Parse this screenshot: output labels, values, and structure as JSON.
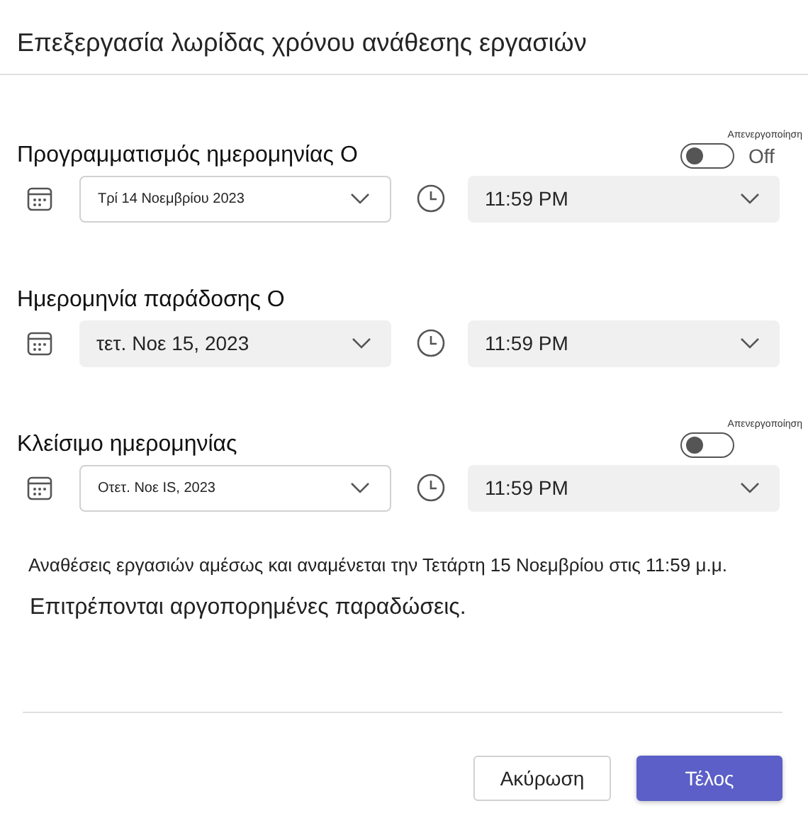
{
  "dialog": {
    "title": "Επεξεργασία λωρίδας χρόνου ανάθεσης εργασιών"
  },
  "sections": [
    {
      "label": "Προγραμματισμός ημερομηνίας Ο",
      "toggle": {
        "caption": "Απενεργοποίηση",
        "state_text": "Off",
        "on": false
      },
      "date": {
        "value": "Τρί 14 Νοεμβρίου 2023",
        "kind": "outlined"
      },
      "time": {
        "value": "11:59 PM"
      }
    },
    {
      "label": "Ημερομηνία παράδοσης Ο",
      "date": {
        "value": "τετ. Νοε 15, 2023",
        "kind": "filled"
      },
      "time": {
        "value": "11:59 PM"
      }
    },
    {
      "label": "Κλείσιμο ημερομηνίας",
      "toggle": {
        "caption": "Απενεργοποίηση",
        "on": false
      },
      "date": {
        "value": "Οτετ. Νοε IS, 2023",
        "kind": "outlined"
      },
      "time": {
        "value": "11:59 PM"
      }
    }
  ],
  "summary": [
    "Αναθέσεις εργασιών αμέσως και αναμένεται την Τετάρτη 15 Νοεμβρίου στις 11:59 μ.μ.",
    "Επιτρέπονται αργοπορημένες παραδώσεις."
  ],
  "buttons": [
    {
      "label": "Ακύρωση",
      "kind": "secondary"
    },
    {
      "label": "Τέλος",
      "kind": "primary"
    }
  ]
}
